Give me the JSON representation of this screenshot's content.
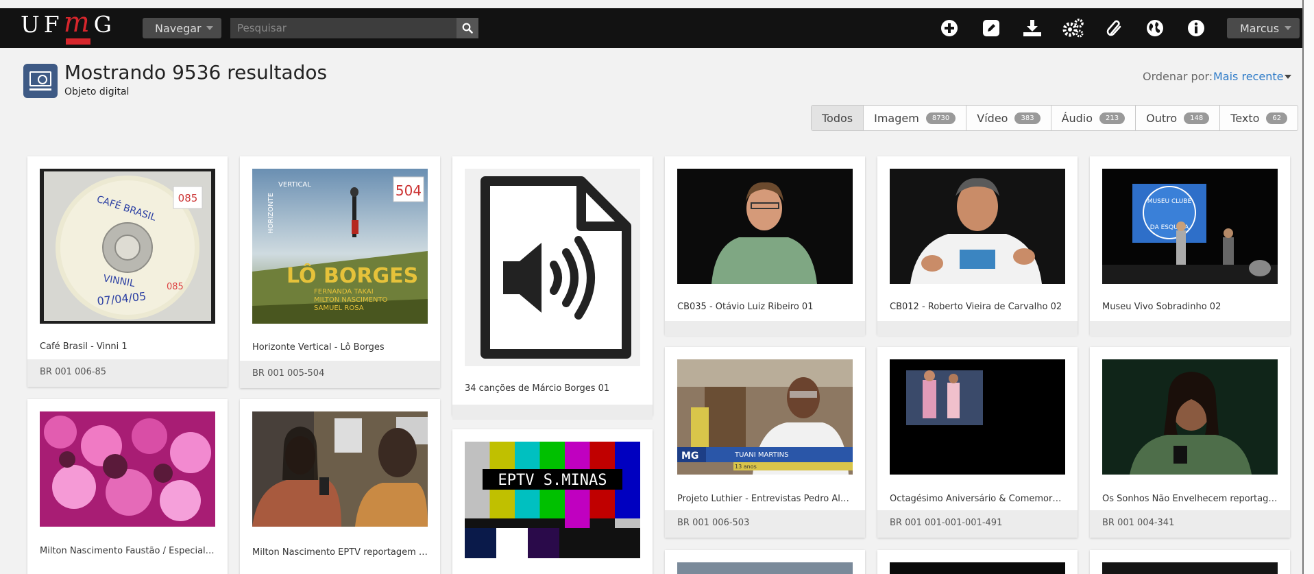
{
  "logo": {
    "letters": "UF",
    "m": "m",
    "g": "G"
  },
  "topbar": {
    "navigate_label": "Navegar",
    "search_placeholder": "Pesquisar",
    "user_label": "Marcus",
    "icons": [
      "plus-circle-icon",
      "edit-icon",
      "download-icon",
      "gears-icon",
      "paperclip-icon",
      "globe-icon",
      "info-icon"
    ]
  },
  "page": {
    "title": "Mostrando 9536 resultados",
    "subtitle": "Objeto digital",
    "sort_label": "Ordenar por:",
    "sort_value": "Mais recente"
  },
  "filters": [
    {
      "label": "Todos",
      "count": ""
    },
    {
      "label": "Imagem",
      "count": "8730"
    },
    {
      "label": "Vídeo",
      "count": "383"
    },
    {
      "label": "Áudio",
      "count": "213"
    },
    {
      "label": "Outro",
      "count": "148"
    },
    {
      "label": "Texto",
      "count": "62"
    }
  ],
  "results": [
    {
      "title": "Café Brasil - Vinni 1",
      "id": "BR 001 006-85"
    },
    {
      "title": "Horizonte Vertical - Lô Borges",
      "id": "BR 001 005-504"
    },
    {
      "title": "34 canções de Márcio Borges 01",
      "id": ""
    },
    {
      "title": "CB035 - Otávio Luiz Ribeiro 01",
      "id": ""
    },
    {
      "title": "CB012 - Roberto Vieira de Carvalho 02",
      "id": ""
    },
    {
      "title": "Museu Vivo Sobradinho 02",
      "id": ""
    },
    {
      "title": "Milton Nascimento Faustão / Especial Elis",
      "id": ""
    },
    {
      "title": "Milton Nascimento EPTV reportagem e...",
      "id": ""
    },
    {
      "title": "Projeto Luthier - Entrevistas Pedro Alex...",
      "id": "BR 001 006-503"
    },
    {
      "title": "Octagésimo Aniversário & Comemoraç...",
      "id": "BR 001 001-001-001-491"
    },
    {
      "title": "Os Sonhos Não Envelhecem reportage...",
      "id": "BR 001 004-341"
    }
  ],
  "thumb_text": {
    "cd_line1": "CAFÉ BRASIL",
    "cd_number": "085",
    "cd_line2": "VINNIL",
    "cd_date": "07/04/05",
    "album_word1": "HORIZONTE",
    "album_word2": "VERTICAL",
    "album_number": "504",
    "album_artist": "LÔ BORGES",
    "album_guest1": "FERNANDA TAKAI",
    "album_guest2": "MILTON NASCIMENTO",
    "album_guest3": "SAMUEL ROSA",
    "museum_sign1": "MUSEU CLUBE",
    "museum_sign2": "DA ESQUINA",
    "luthier_channel": "MG",
    "luthier_name": "TUANI MARTINS",
    "luthier_age": "13 anos",
    "tv_banner": "EPTV S.MINAS"
  },
  "colors": {
    "accent": "#2b79c7",
    "logo_red": "#d6262c",
    "topbar": "#121212",
    "icon_tile": "#3e5a85"
  }
}
